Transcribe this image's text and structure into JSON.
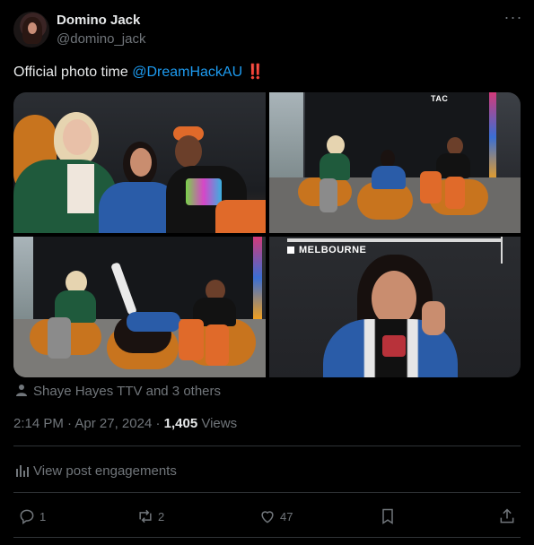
{
  "author": {
    "display_name": "Domino Jack",
    "handle": "@domino_jack"
  },
  "tweet": {
    "text_prefix": "Official photo time ",
    "mention": "@DreamHackAU",
    "text_suffix": " ‼️"
  },
  "media": {
    "photo_1_signs": "",
    "photo_2_brand": "TAC",
    "photo_4_brand": "MELBOURNE"
  },
  "social_context": "Shaye Hayes TTV and 3 others",
  "meta": {
    "time": "2:14 PM",
    "separator": " · ",
    "date": "Apr 27, 2024",
    "views_count": "1,405",
    "views_label": " Views"
  },
  "engagement_link": "View post engagements",
  "actions": {
    "replies": "1",
    "reposts": "2",
    "likes": "47"
  },
  "icons": [
    "more-icon",
    "person-icon",
    "analytics-icon",
    "reply-icon",
    "repost-icon",
    "like-icon",
    "bookmark-icon",
    "share-icon"
  ],
  "colors": {
    "background": "#000000",
    "text": "#e7e9ea",
    "secondary": "#71767b",
    "accent": "#1d9bf0",
    "divider": "#2f3336"
  }
}
